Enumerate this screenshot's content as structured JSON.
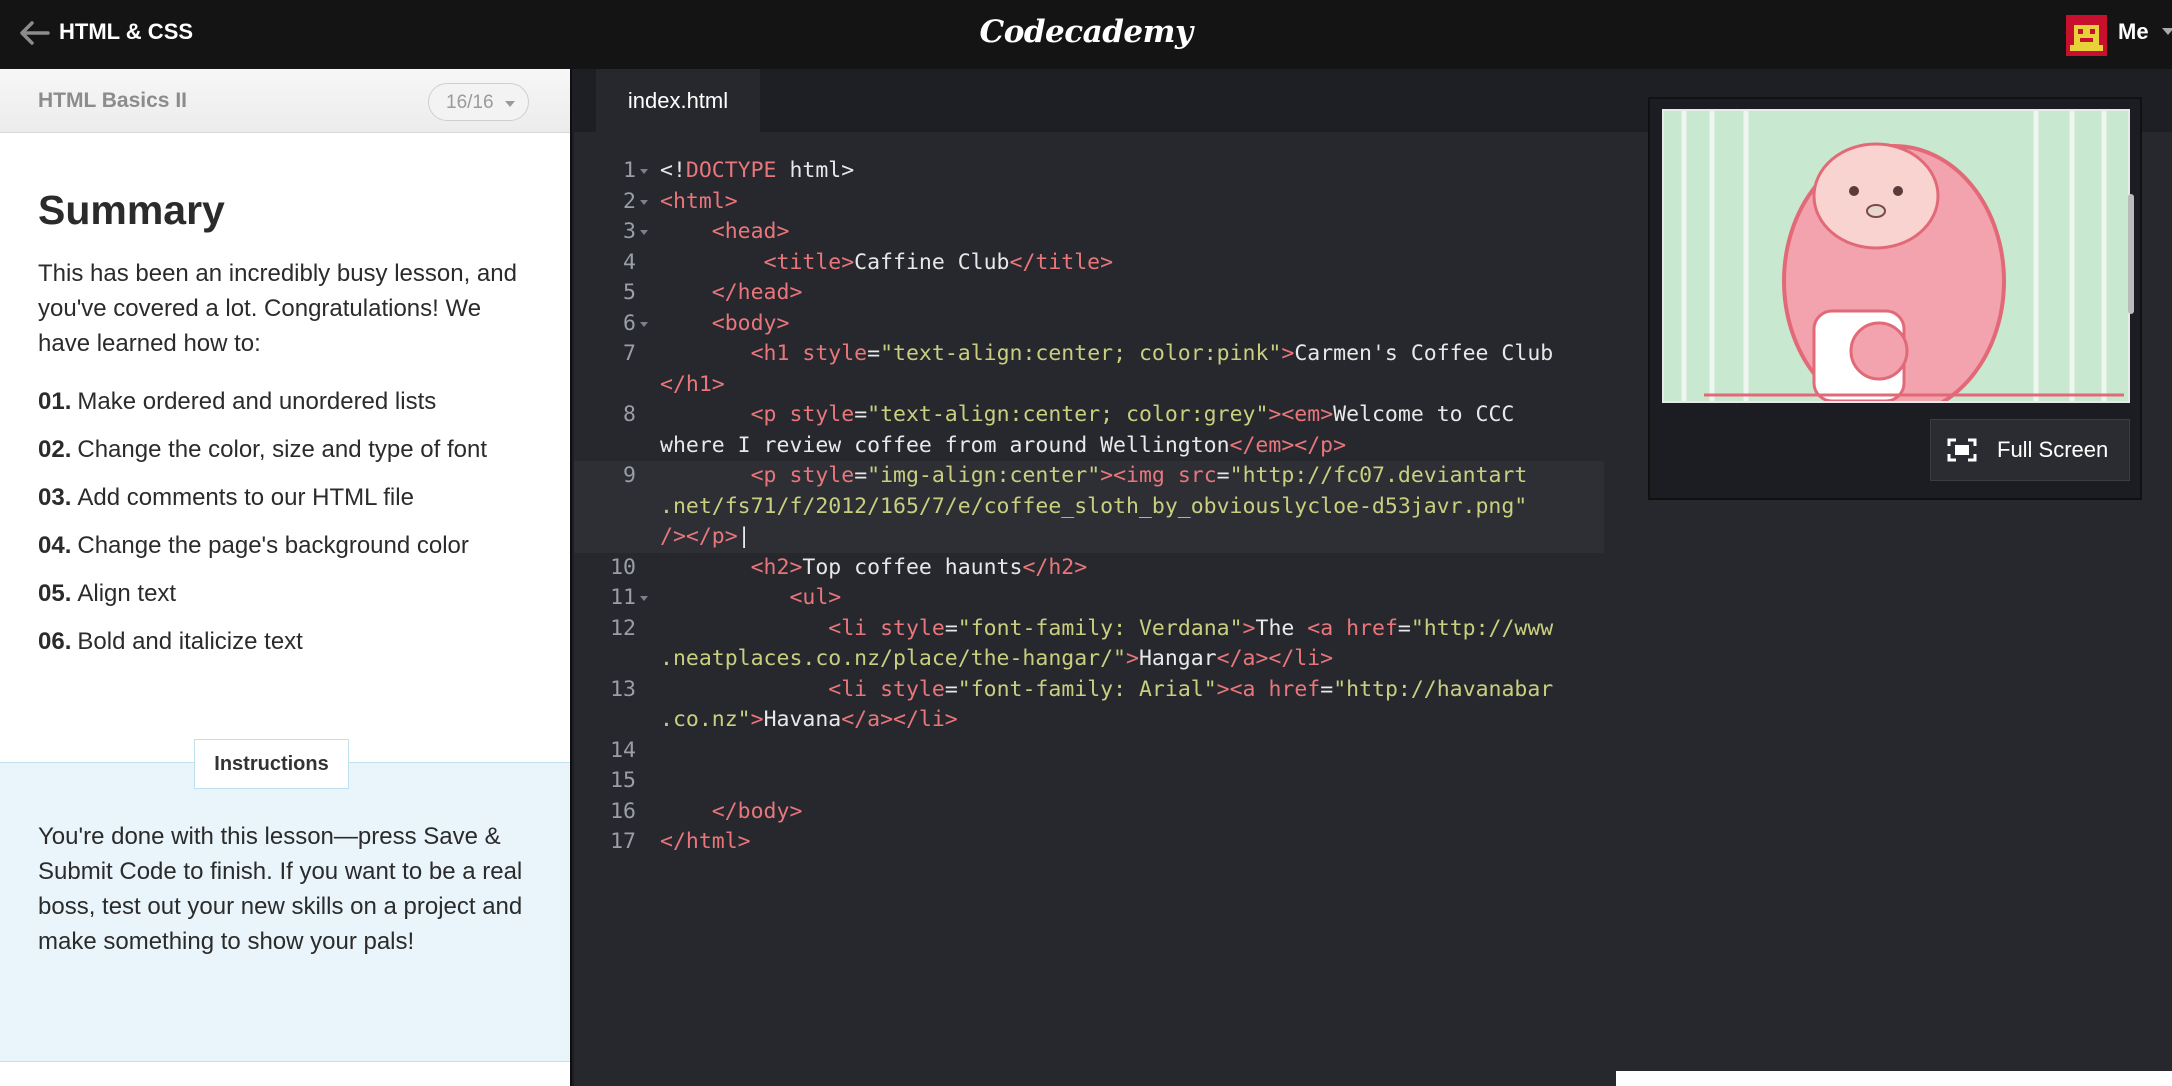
{
  "topbar": {
    "course_title": "HTML & CSS",
    "logo": "Codecademy",
    "user_label": "Me"
  },
  "lesson": {
    "unit_name": "HTML Basics II",
    "progress": "16/16",
    "title": "Summary",
    "intro": "This has been an incredibly busy lesson, and you've covered a lot. Congratulations! We have learned how to:",
    "steps": [
      {
        "num": "01.",
        "text": "Make ordered and unordered lists"
      },
      {
        "num": "02.",
        "text": "Change the color, size and type of font"
      },
      {
        "num": "03.",
        "text": "Add comments to our HTML file"
      },
      {
        "num": "04.",
        "text": "Change the page's background color"
      },
      {
        "num": "05.",
        "text": "Align text"
      },
      {
        "num": "06.",
        "text": "Bold and italicize text"
      }
    ],
    "instructions_label": "Instructions",
    "instructions_text": "You're done with this lesson—press Save & Submit Code to finish. If you want to be a real boss, test out your new skills on a project and make something to show your pals!"
  },
  "editor": {
    "tab": "index.html",
    "line_numbers": [
      "1",
      "2",
      "3",
      "4",
      "5",
      "6",
      "7",
      "8",
      "9",
      "10",
      "11",
      "12",
      "13",
      "14",
      "15",
      "16",
      "17"
    ],
    "active_line": "9"
  },
  "preview": {
    "fullscreen_label": "Full Screen"
  },
  "colors": {
    "topbar": "#141414",
    "editor_bg": "#26282e",
    "tag": "#e8767a",
    "string": "#c9cf7e",
    "instructions_bg": "#e9f5fb"
  }
}
